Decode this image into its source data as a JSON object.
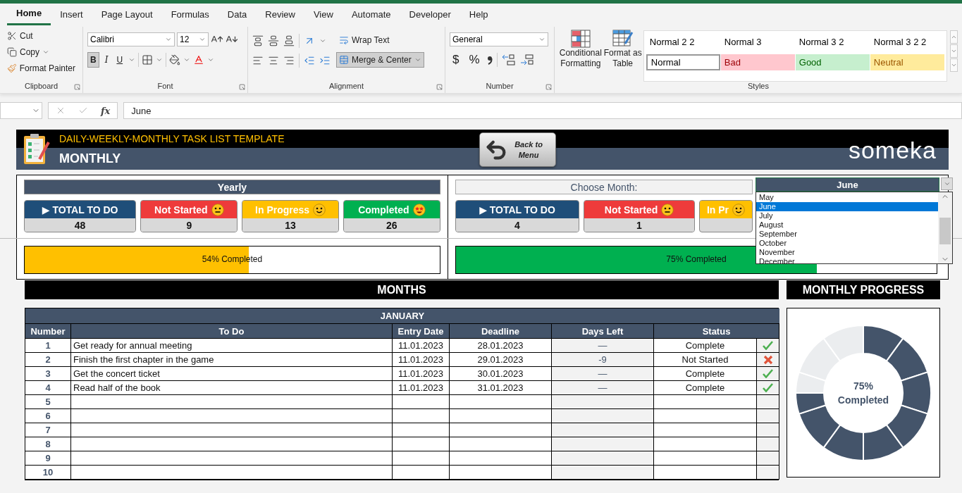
{
  "ribbon_tabs": [
    {
      "label": "Home",
      "selected": true
    },
    {
      "label": "Insert",
      "selected": false
    },
    {
      "label": "Page Layout",
      "selected": false
    },
    {
      "label": "Formulas",
      "selected": false
    },
    {
      "label": "Data",
      "selected": false
    },
    {
      "label": "Review",
      "selected": false
    },
    {
      "label": "View",
      "selected": false
    },
    {
      "label": "Automate",
      "selected": false
    },
    {
      "label": "Developer",
      "selected": false
    },
    {
      "label": "Help",
      "selected": false
    }
  ],
  "clipboard": {
    "cut": "Cut",
    "copy": "Copy",
    "format_painter": "Format Painter",
    "label": "Clipboard"
  },
  "font": {
    "name": "Calibri",
    "size": "12",
    "bold": "B",
    "italic": "I",
    "underline": "U",
    "label": "Font"
  },
  "alignment": {
    "wrap_text": "Wrap Text",
    "merge": "Merge & Center",
    "label": "Alignment"
  },
  "number": {
    "format": "General",
    "currency": "$",
    "percent": "%",
    "label": "Number"
  },
  "styles": {
    "conditional": "Conditional Formatting",
    "format_table": "Format as Table",
    "label": "Styles",
    "gallery": [
      {
        "label": "Normal 2 2",
        "kind": "plain"
      },
      {
        "label": "Normal 3",
        "kind": "plain"
      },
      {
        "label": "Normal 3 2",
        "kind": "plain"
      },
      {
        "label": "Normal 3 2 2",
        "kind": "plain"
      },
      {
        "label": "Normal",
        "kind": "normal"
      },
      {
        "label": "Bad",
        "kind": "bad"
      },
      {
        "label": "Good",
        "kind": "good"
      },
      {
        "label": "Neutral",
        "kind": "neutral"
      }
    ]
  },
  "formula_bar": {
    "function_label": "fx",
    "value": "June"
  },
  "banner": {
    "subtitle": "DAILY-WEEKLY-MONTHLY TASK LIST TEMPLATE",
    "title": "MONTHLY",
    "back_button": "Back to Menu",
    "logo": "someka"
  },
  "yearly": {
    "title": "Yearly",
    "cards": [
      {
        "label": "▶ TOTAL TO DO",
        "kind": "total",
        "value": "48"
      },
      {
        "label": "Not Started",
        "kind": "not_started",
        "value": "9"
      },
      {
        "label": "In Progress",
        "kind": "in_progress",
        "value": "13"
      },
      {
        "label": "Completed",
        "kind": "completed",
        "value": "26"
      }
    ],
    "progress": {
      "level": 0.54,
      "reading": "54% Completed"
    }
  },
  "monthly": {
    "prompt": "Choose Month:",
    "month": "June",
    "cards": [
      {
        "label": "▶ TOTAL TO DO",
        "kind": "total",
        "value": "4"
      },
      {
        "label": "Not Started",
        "kind": "not_started",
        "value": "1"
      },
      {
        "label": "In Pr",
        "kind": "in_progress"
      }
    ],
    "options": [
      {
        "label": "May",
        "selected": false
      },
      {
        "label": "June",
        "selected": true
      },
      {
        "label": "July",
        "selected": false
      },
      {
        "label": "August",
        "selected": false
      },
      {
        "label": "September",
        "selected": false
      },
      {
        "label": "October",
        "selected": false
      },
      {
        "label": "November",
        "selected": false
      },
      {
        "label": "December",
        "selected": false
      }
    ],
    "progress": {
      "level": 0.75,
      "reading": "75% Completed"
    }
  },
  "months_title": "MONTHS",
  "table": {
    "title": "JANUARY",
    "columns": [
      "Number",
      "To Do",
      "Entry Date",
      "Deadline",
      "Days Left",
      "Status"
    ],
    "rows": [
      {
        "number": "1",
        "todo": "Get ready for annual meeting",
        "entry": "11.01.2023",
        "deadline": "28.01.2023",
        "days_left": "—",
        "status": "Complete",
        "done": true
      },
      {
        "number": "2",
        "todo": "Finish the first chapter in the game",
        "entry": "11.01.2023",
        "deadline": "29.01.2023",
        "days_left": "-9",
        "status": "Not Started",
        "done": false
      },
      {
        "number": "3",
        "todo": "Get the concert ticket",
        "entry": "11.01.2023",
        "deadline": "30.01.2023",
        "days_left": "—",
        "status": "Complete",
        "done": true
      },
      {
        "number": "4",
        "todo": "Read half of the book",
        "entry": "11.01.2023",
        "deadline": "31.01.2023",
        "days_left": "—",
        "status": "Complete",
        "done": true
      },
      {
        "number": "5"
      },
      {
        "number": "6"
      },
      {
        "number": "7"
      },
      {
        "number": "8"
      },
      {
        "number": "9"
      },
      {
        "number": "10"
      }
    ]
  },
  "progress_panel": {
    "title": "MONTHLY PROGRESS",
    "level": 0.75,
    "reading": "75%",
    "caption": "Completed"
  }
}
